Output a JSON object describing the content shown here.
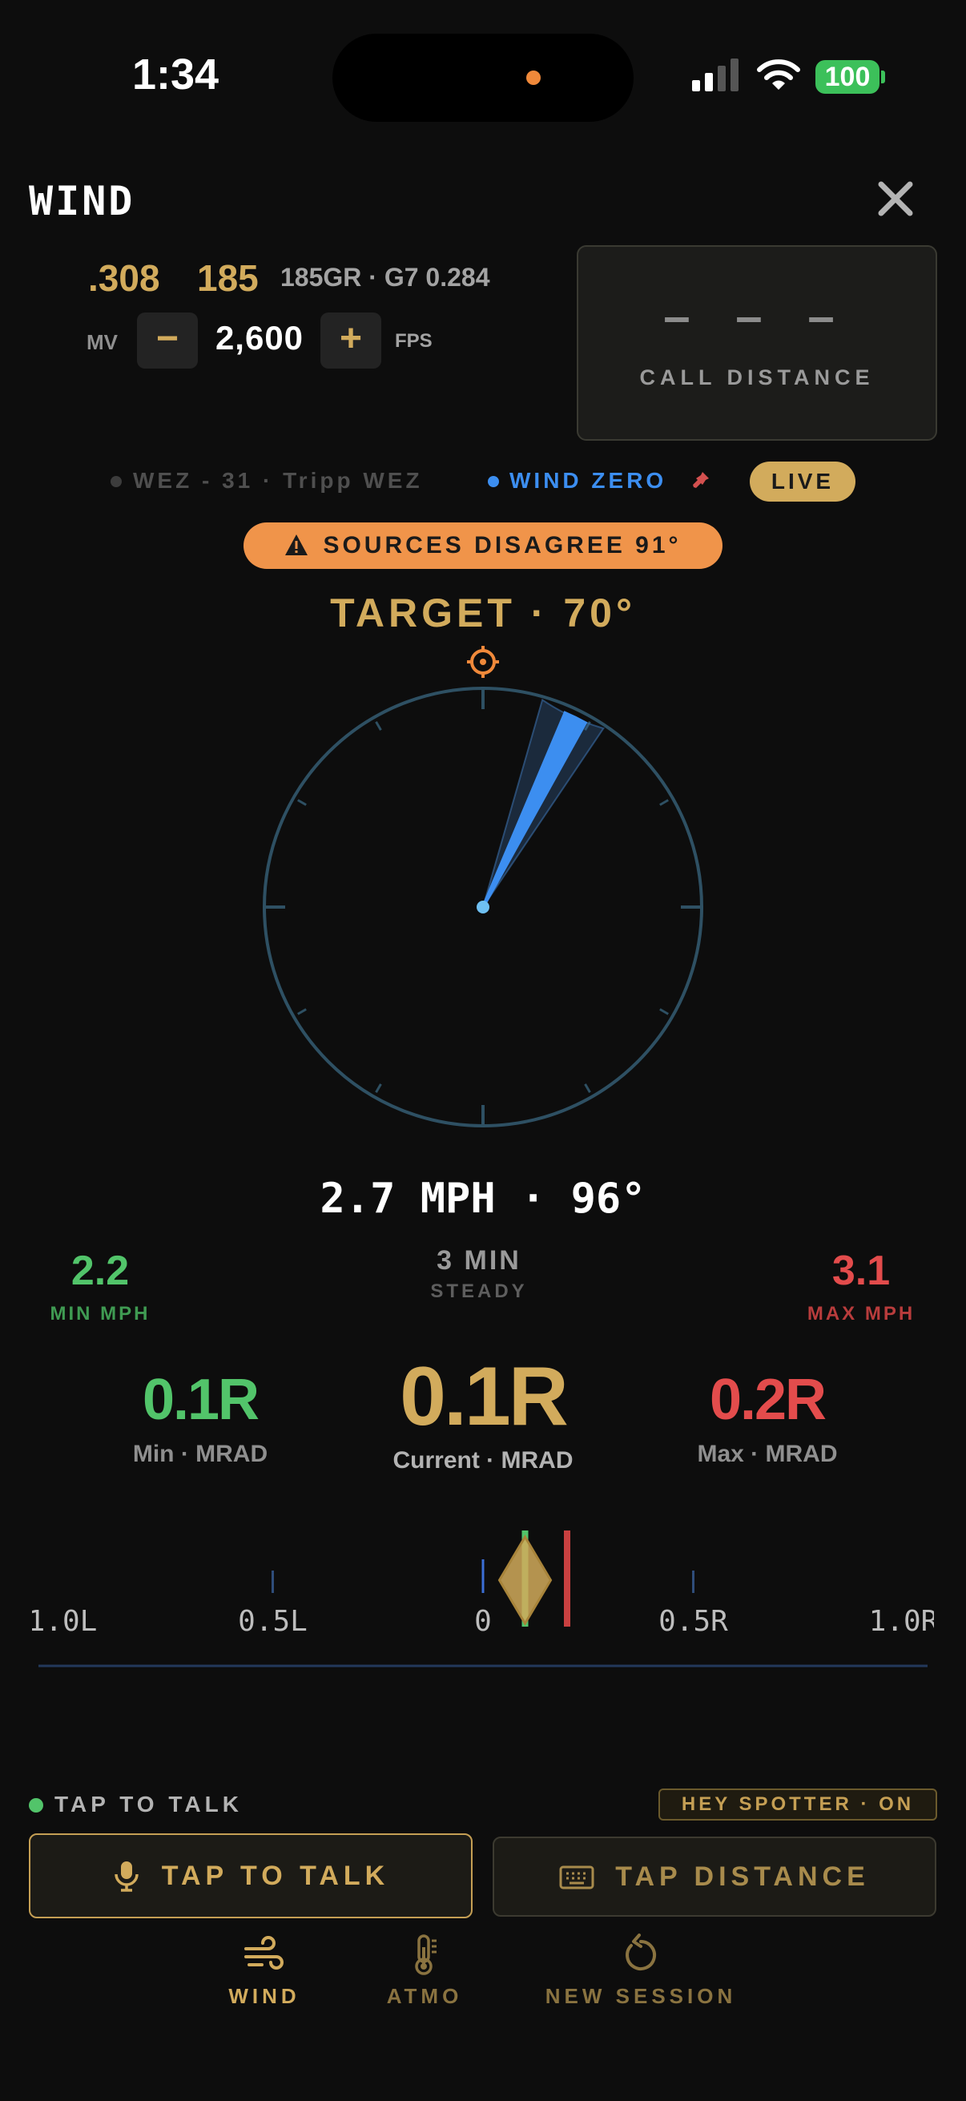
{
  "status_bar": {
    "time": "1:34",
    "battery": "100"
  },
  "header": {
    "title": "WIND"
  },
  "load": {
    "caliber": ".308",
    "weight": "185",
    "bullet": "185GR · G7 0.284"
  },
  "mv": {
    "label": "MV",
    "minus": "−",
    "value": "2,600",
    "plus": "+",
    "unit": "FPS"
  },
  "call_distance": {
    "dashes": "– – –",
    "label": "CALL DISTANCE"
  },
  "sources": {
    "wez_label": "WEZ - 31 · Tripp WEZ",
    "wind_zero_label": "WIND ZERO",
    "live_label": "LIVE"
  },
  "alert": {
    "label": "SOURCES DISAGREE 91°"
  },
  "target": {
    "label": "TARGET · 70°"
  },
  "compass": {
    "target_deg": 70,
    "wind_from_deg": 96,
    "spread_from_deg": 86,
    "spread_to_deg": 104
  },
  "wind": {
    "speed_line": "2.7 MPH · 96°"
  },
  "stats": {
    "min_value": "2.2",
    "min_label": "MIN MPH",
    "duration_value": "3 MIN",
    "duration_label": "STEADY",
    "max_value": "3.1",
    "max_label": "MAX MPH"
  },
  "holds": {
    "min_value": "0.1R",
    "min_label": "Min · MRAD",
    "current_value": "0.1R",
    "current_label": "Current · MRAD",
    "max_value": "0.2R",
    "max_label": "Max · MRAD"
  },
  "scale": {
    "ticks": [
      "1.0L",
      "0.5L",
      "0",
      "0.5R",
      "1.0R"
    ],
    "tick_values": [
      -1.0,
      -0.5,
      0,
      0.5,
      1.0
    ],
    "min": 0.1,
    "current": 0.1,
    "max": 0.2
  },
  "voice": {
    "status": "TAP TO TALK",
    "spotter": "HEY SPOTTER · ON"
  },
  "buttons": {
    "talk": "TAP TO TALK",
    "distance": "TAP DISTANCE"
  },
  "tabs": {
    "wind": "WIND",
    "atmo": "ATMO",
    "new_session": "NEW SESSION"
  },
  "colors": {
    "accent": "#d2ab5c",
    "blue": "#3c8ef0",
    "green": "#52c46a",
    "red": "#e34c4c",
    "orange": "#f0944a"
  }
}
